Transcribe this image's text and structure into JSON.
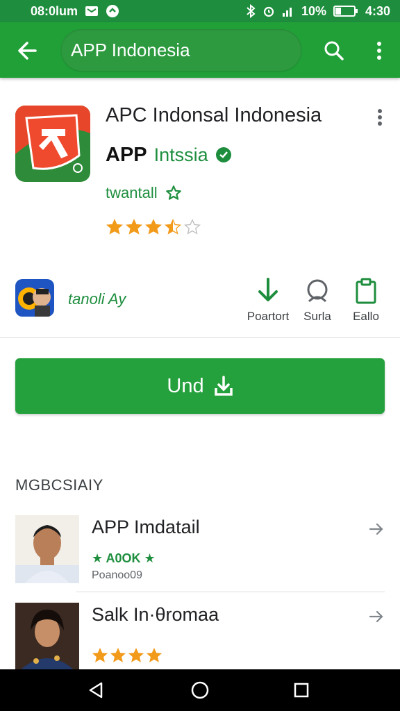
{
  "status_bar": {
    "time": "08:0lum",
    "battery_percent": "10%",
    "clock": "4:30"
  },
  "app_bar": {
    "search_text": "APP Indonesia"
  },
  "app": {
    "title": "APC Indonsal Indonesia",
    "developer_prefix": "APP",
    "developer_name": "Intssia",
    "category": "twantall",
    "rating_stars": 3.5,
    "rating_max": 5
  },
  "info_row": {
    "developer_label": "tanoli Ay",
    "actions": [
      {
        "label": "Poartort",
        "icon": "download-arrow-icon"
      },
      {
        "label": "Surla",
        "icon": "user-ring-icon"
      },
      {
        "label": "Eallo",
        "icon": "clipboard-icon"
      }
    ]
  },
  "install_button": {
    "label": "Und"
  },
  "section": {
    "title": "MGBCSIAIY"
  },
  "list": [
    {
      "title": "APP Imdatail",
      "rating_text": "★ A0OK ★",
      "subtitle": "Poanoo09"
    },
    {
      "title": "Salk In·θromaa",
      "stars": 4
    }
  ],
  "colors": {
    "primary": "#21a038",
    "status": "#1e8e3e",
    "accent_text": "#1e8e3e",
    "star": "#f29a1a",
    "install": "#24a13d"
  }
}
